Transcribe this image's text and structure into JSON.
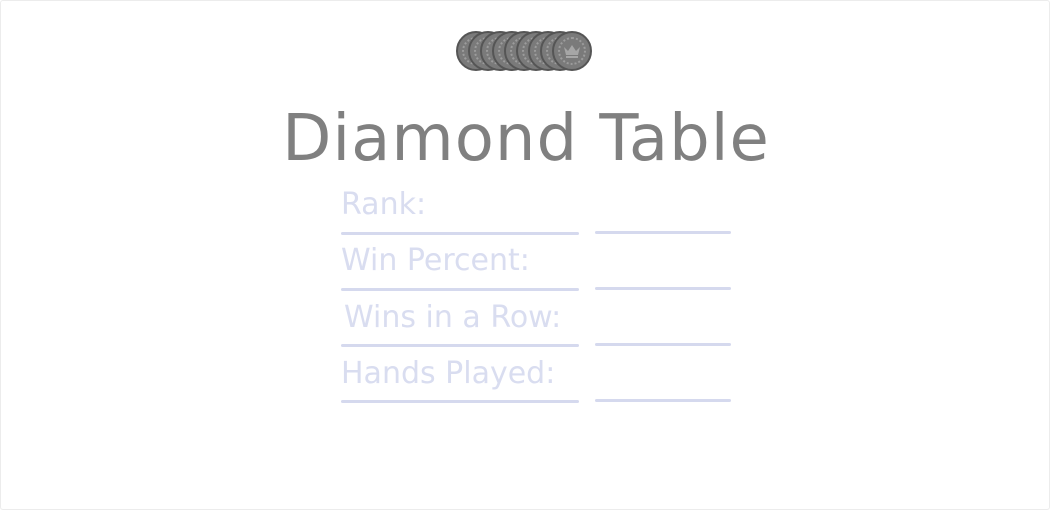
{
  "table": {
    "title": "Diamond Table",
    "chip_icon": "crown-icon",
    "chip_count": 9
  },
  "stats": [
    {
      "label": "Rank:",
      "value": ""
    },
    {
      "label": "Win Percent:",
      "value": ""
    },
    {
      "label": "Wins in a Row:",
      "value": ""
    },
    {
      "label": "Hands Played:",
      "value": ""
    }
  ],
  "colors": {
    "title": "#808080",
    "chip": "#7a7a7a",
    "chip_border": "#555555",
    "stat_text": "#d9ddf0",
    "stat_rule": "#d5d9ee"
  }
}
